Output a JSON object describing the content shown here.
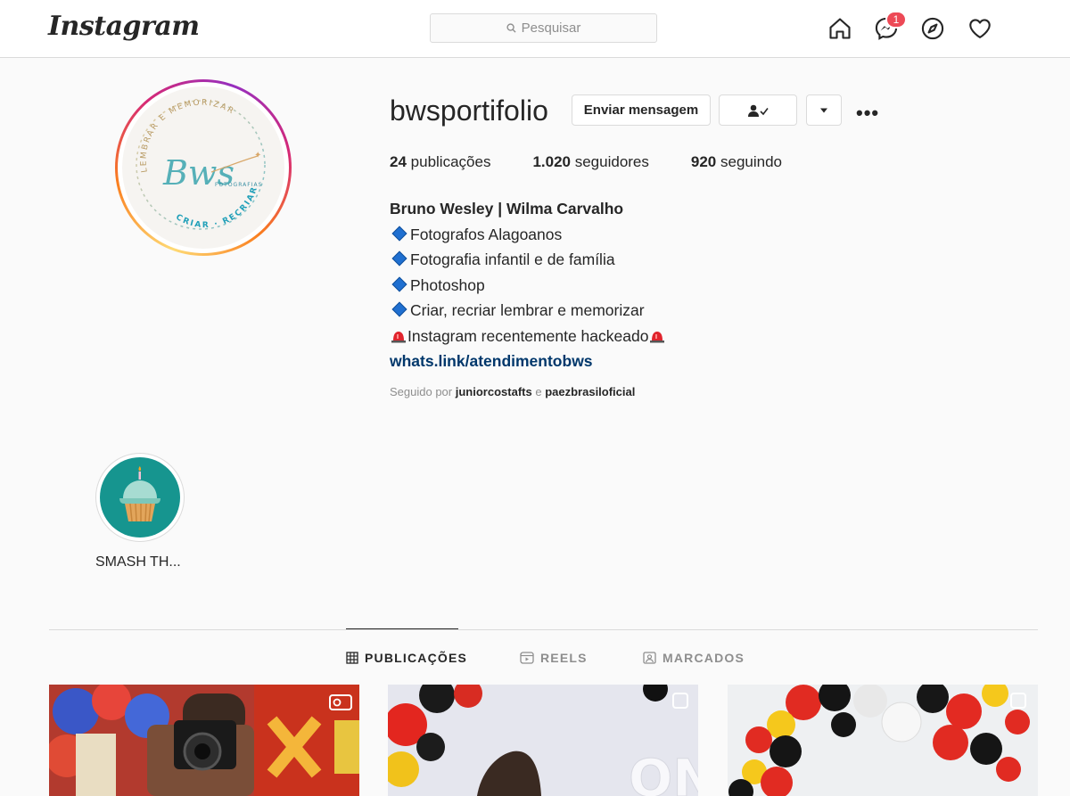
{
  "nav": {
    "logo": "Instagram",
    "search_placeholder": "Pesquisar",
    "messages_badge": "1"
  },
  "profile": {
    "username": "bwsportifolio",
    "message_button": "Enviar mensagem",
    "stats": {
      "posts_count": "24",
      "posts_label": "publicações",
      "followers_count": "1.020",
      "followers_label": "seguidores",
      "following_count": "920",
      "following_label": "seguindo"
    },
    "bio": {
      "name": "Bruno Wesley | Wilma Carvalho",
      "lines": [
        "Fotografos Alagoanos",
        "Fotografia infantil e de família",
        "Photoshop",
        "Criar, recriar lembrar e memorizar",
        "Instagram recentemente hackeado"
      ],
      "link": "whats.link/atendimentobws"
    },
    "followed_by_prefix": "Seguido por",
    "followed_by_user1": "juniorcostafts",
    "followed_by_sep": "e",
    "followed_by_user2": "paezbrasiloficial"
  },
  "avatar": {
    "logo_text": "Bws",
    "logo_sub": "FOTOGRAFIAS",
    "ring_text_top": "LEMBRAR E MEMORIZAR",
    "ring_text_bottom": "CRIAR · RECRIAR ·"
  },
  "highlights": [
    {
      "label": "SMASH TH..."
    }
  ],
  "tabs": [
    {
      "label": "PUBLICAÇÕES",
      "active": true
    },
    {
      "label": "REELS",
      "active": false
    },
    {
      "label": "MARCADOS",
      "active": false
    }
  ],
  "colors": {
    "link": "#00376b",
    "badge": "#ed4956",
    "highlight_bg": "#16958f"
  }
}
